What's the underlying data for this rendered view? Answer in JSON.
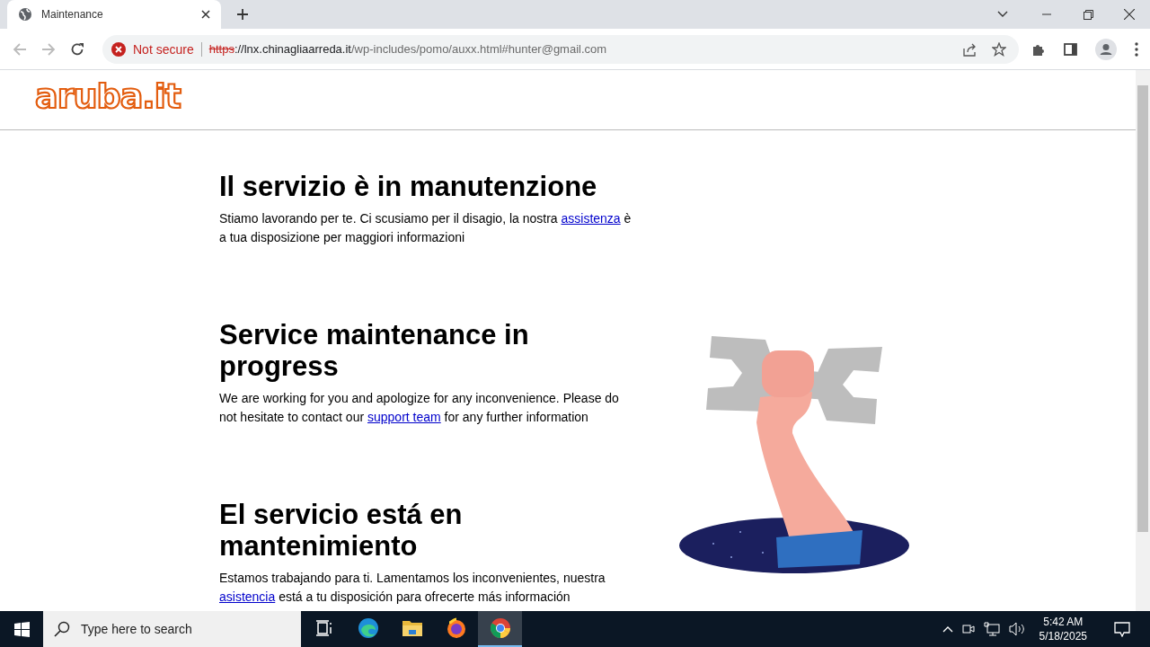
{
  "browser": {
    "tabs": [
      {
        "title": "Maintenance",
        "selected": true
      }
    ],
    "address_bar": {
      "security": "Not secure",
      "scheme": "https",
      "host": "://lnx.chinagliaarreda.it",
      "path": "/wp-includes/pomo/auxx.html#hunter@gmail.com"
    }
  },
  "page": {
    "logo": "aruba.it",
    "sections": [
      {
        "heading": "Il servizio è in manutenzione",
        "before": "Stiamo lavorando per te. Ci scusiamo per il disagio, la nostra ",
        "link": "assistenza",
        "after": " è a tua disposizione per maggiori informazioni"
      },
      {
        "heading": "Service maintenance in progress",
        "before": "We are working for you and apologize for any inconvenience. Please do not hesitate to contact our ",
        "link": "support team",
        "after": " for any further information"
      },
      {
        "heading": "El servicio está en mantenimiento",
        "before": "Estamos trabajando para ti. Lamentamos los inconvenientes, nuestra ",
        "link": "asistencia",
        "after": " está a tu disposición para ofrecerte más información"
      }
    ]
  },
  "taskbar": {
    "search_placeholder": "Type here to search",
    "apps": [
      {
        "kind": "task-view",
        "selected": false
      },
      {
        "kind": "edge",
        "selected": false
      },
      {
        "kind": "explorer",
        "selected": false
      },
      {
        "kind": "firefox",
        "selected": false
      },
      {
        "kind": "chrome",
        "selected": true
      }
    ],
    "time": "5:42 AM",
    "date": "5/18/2025"
  }
}
